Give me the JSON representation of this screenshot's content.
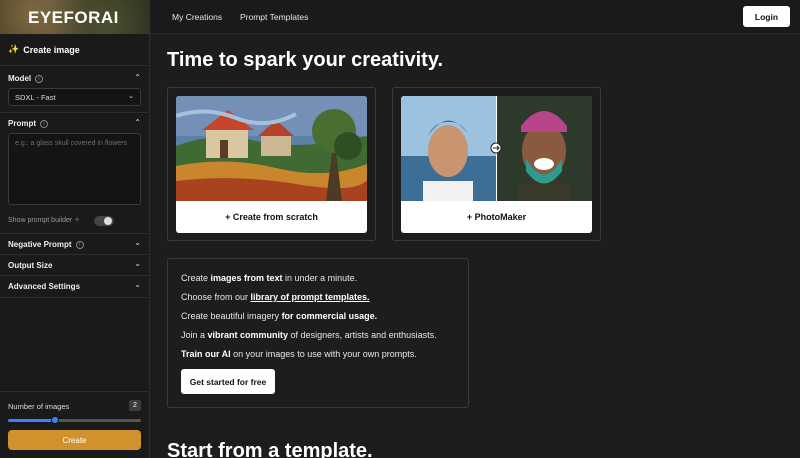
{
  "header": {
    "logo": "EYEFORAI",
    "nav": [
      "My Creations",
      "Prompt Templates"
    ],
    "login_label": "Login"
  },
  "sidebar": {
    "title": "Create image",
    "model_label": "Model",
    "model_value": "SDXL - Fast",
    "prompt_label": "Prompt",
    "prompt_placeholder": "e.g.: a glass skull covered in flowers",
    "prompt_builder_label": "Show prompt builder",
    "sections": [
      "Negative Prompt",
      "Output Size",
      "Advanced Settings"
    ],
    "num_images_label": "Number of images",
    "num_images_value": "2",
    "num_images_slider_fraction": 0.35,
    "create_label": "Create"
  },
  "main": {
    "title": "Time to spark your creativity.",
    "cards": [
      {
        "label": "+ Create from scratch"
      },
      {
        "label": "+ PhotoMaker"
      }
    ],
    "info": {
      "line1_a": "Create ",
      "line1_b": "images from text",
      "line1_c": " in under a minute.",
      "line2_a": "Choose from our ",
      "line2_b": "library of prompt templates.",
      "line3_a": "Create beautiful imagery ",
      "line3_b": "for commercial usage.",
      "line4_a": "Join a ",
      "line4_b": "vibrant community",
      "line4_c": " of designers, artists and enthusiasts.",
      "line5_a": "Train our AI",
      "line5_b": " on your images to use with your own prompts.",
      "cta": "Get started for free"
    },
    "section_title": "Start from a template."
  },
  "colors": {
    "accent": "#d1922e",
    "slider": "#3b82f6",
    "background": "#1d1d1d"
  }
}
